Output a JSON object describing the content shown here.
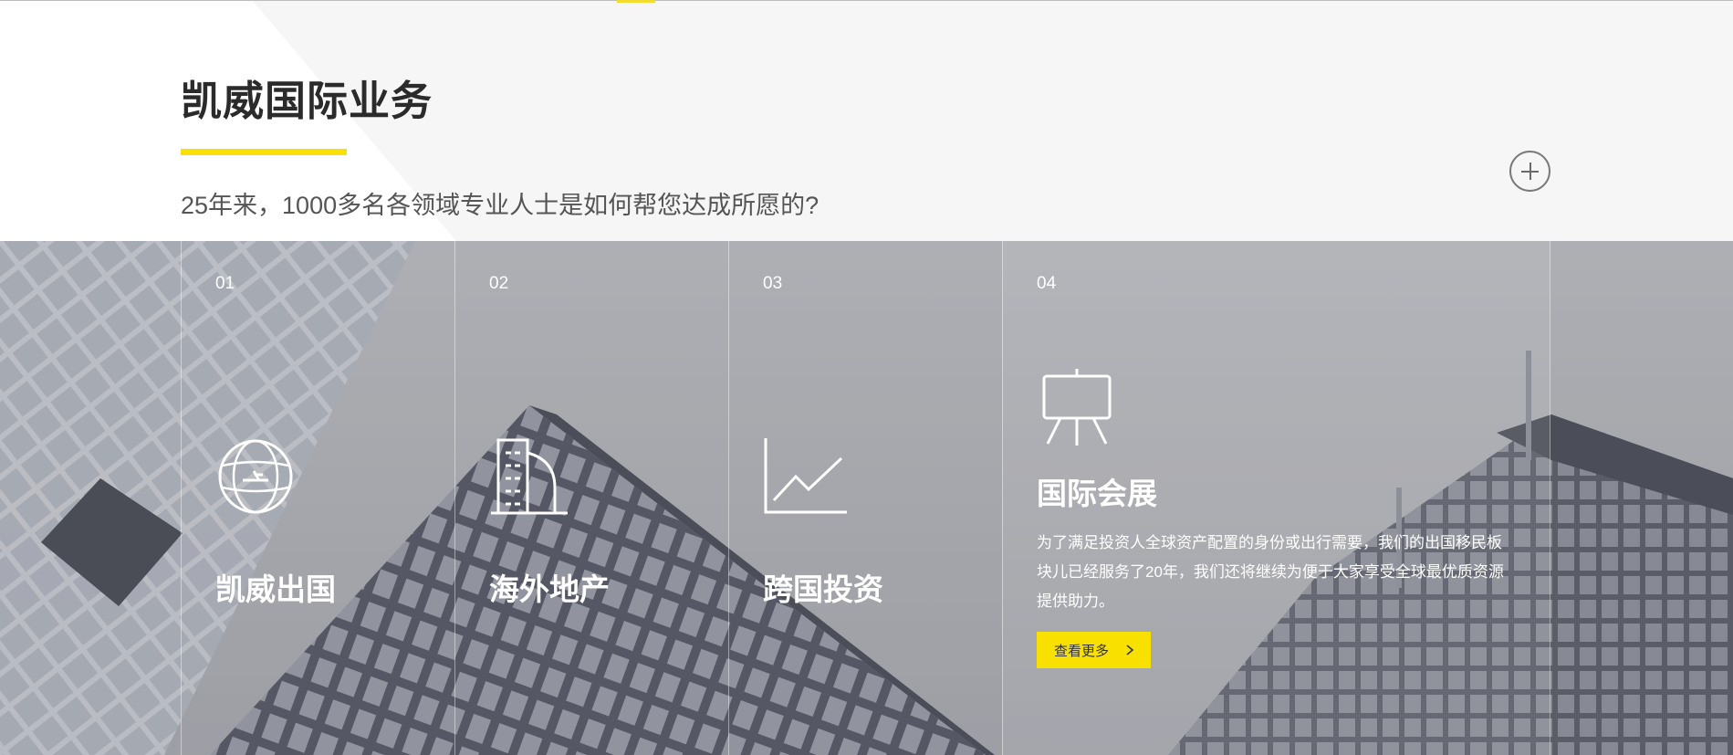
{
  "header": {
    "title": "凯威国际业务",
    "subtitle": "25年来，1000多名各领域专业人士是如何帮您达成所愿的?"
  },
  "panels": [
    {
      "num": "01",
      "title": "凯威出国",
      "icon": "globe-plane-icon"
    },
    {
      "num": "02",
      "title": "海外地产",
      "icon": "building-icon"
    },
    {
      "num": "03",
      "title": "跨国投资",
      "icon": "line-chart-icon"
    },
    {
      "num": "04",
      "title": "国际会展",
      "icon": "presentation-board-icon",
      "description": "为了满足投资人全球资产配置的身份或出行需要，我们的出国移民板块儿已经服务了20年，我们还将继续为便于大家享受全球最优质资源提供助力。",
      "more_label": "查看更多"
    }
  ],
  "colors": {
    "accent": "#f8e100",
    "title": "#2b2b2b",
    "subtitle": "#555555"
  }
}
